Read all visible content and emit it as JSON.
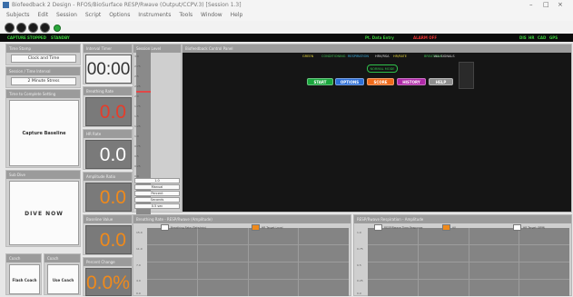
{
  "window": {
    "title": "Biofeedback 2 Design - RFOS/BioSurface RESP/Rwave (Output/CCPV.3) [Session 1.3]",
    "controls": [
      "–",
      "□",
      "×"
    ]
  },
  "menu": [
    "Subjects",
    "Edit",
    "Session",
    "Script",
    "Options",
    "Instruments",
    "Tools",
    "Window",
    "Help"
  ],
  "status_bar": {
    "left": [
      "CAPTURE",
      "STOPPED",
      "STANDBY"
    ],
    "center": "Pt. Data Entry",
    "center_red": "ALARM OFF",
    "right": [
      "DIS",
      "HR",
      "CAD",
      "GPS"
    ]
  },
  "left_panels": {
    "clock_hdr": "Time Stamp",
    "clock_btn": "Clock and Time",
    "interval_hdr": "Session / Time Interval",
    "interval_btn": "2 Minute Stress",
    "capture_hdr": "Time to Complete Setting",
    "capture_btn": "Capture Baseline",
    "dive_hdr": "Sub Dive",
    "dive_btn": "DIVE NOW",
    "coach1_hdr": "Coach",
    "coach1_btn": "Flash Coach",
    "coach2_hdr": "Coach",
    "coach2_btn": "Use Coach"
  },
  "value_panels": {
    "timer": {
      "hdr": "Interval Timer",
      "value": "00:00",
      "color": "#333333"
    },
    "v1": {
      "hdr": "Breathing Rate",
      "value": "0.0",
      "color": "#e53d2b"
    },
    "v2": {
      "hdr": "HR Rate",
      "value": "0.0",
      "color": "#ffffff"
    },
    "v3": {
      "hdr": "Amplitude Ratio",
      "value": "0.0",
      "color": "#f08a1b"
    },
    "v4": {
      "hdr": "Baseline Value",
      "value": "0.0",
      "color": "#f08a1b"
    },
    "v5": {
      "hdr": "Percent Change",
      "value": "0.0%",
      "color": "#f08a1b"
    }
  },
  "ruler": {
    "hdr": "Session Level",
    "ticks": [
      "3.0",
      "2.75",
      "2.5",
      "2.25",
      "2.0",
      "1.75",
      "1.5",
      "1.25",
      "1.0",
      "0.75",
      "0.5",
      "0.25",
      "0.0"
    ],
    "options": [
      "1.0",
      "Manual",
      "Percent",
      "Seconds",
      "0.5 sec"
    ]
  },
  "control_panel": {
    "hdr": "Biofeedback Control Panel",
    "chips": [
      "GREEN",
      "CONDITIONING",
      "RESPIRATION",
      "HRV/RSA",
      "HR/RATE",
      "BREATHING",
      "ALL SIGNALS"
    ],
    "mode_label": "NORMAL MODE",
    "buttons": [
      {
        "label": "START",
        "color": "#1aa63d"
      },
      {
        "label": "OPTIONS",
        "color": "#2e6fd6"
      },
      {
        "label": "SCORE",
        "color": "#ef6a1a"
      },
      {
        "label": "HISTORY",
        "color": "#b02aa8"
      },
      {
        "label": "HELP",
        "color": "#8f8f8f"
      }
    ]
  },
  "chart_left": {
    "hdr": "Breathing Rate - RESP/Rwave (Amplitude)",
    "legend": [
      {
        "label": "Breathing Rate (Rate/min)",
        "swatch": "#ffffff"
      },
      {
        "label": "HR Target Level",
        "swatch": "#f08a1b"
      }
    ],
    "yticks": [
      "15.0",
      "11.0",
      "7.0",
      "4.0",
      "0.0"
    ]
  },
  "chart_right": {
    "hdr": "RESP/Rwave Respiration - Amplitude",
    "legend": [
      {
        "label": "RESP/Rwave Time Response",
        "swatch": "#ffffff"
      },
      {
        "label": "AV",
        "swatch": "#f08a1b"
      },
      {
        "label": "HR Target (BPM)",
        "swatch": "#ffffff"
      }
    ],
    "yticks": [
      "1.0",
      "0.75",
      "0.5",
      "0.25",
      "0.0"
    ]
  }
}
